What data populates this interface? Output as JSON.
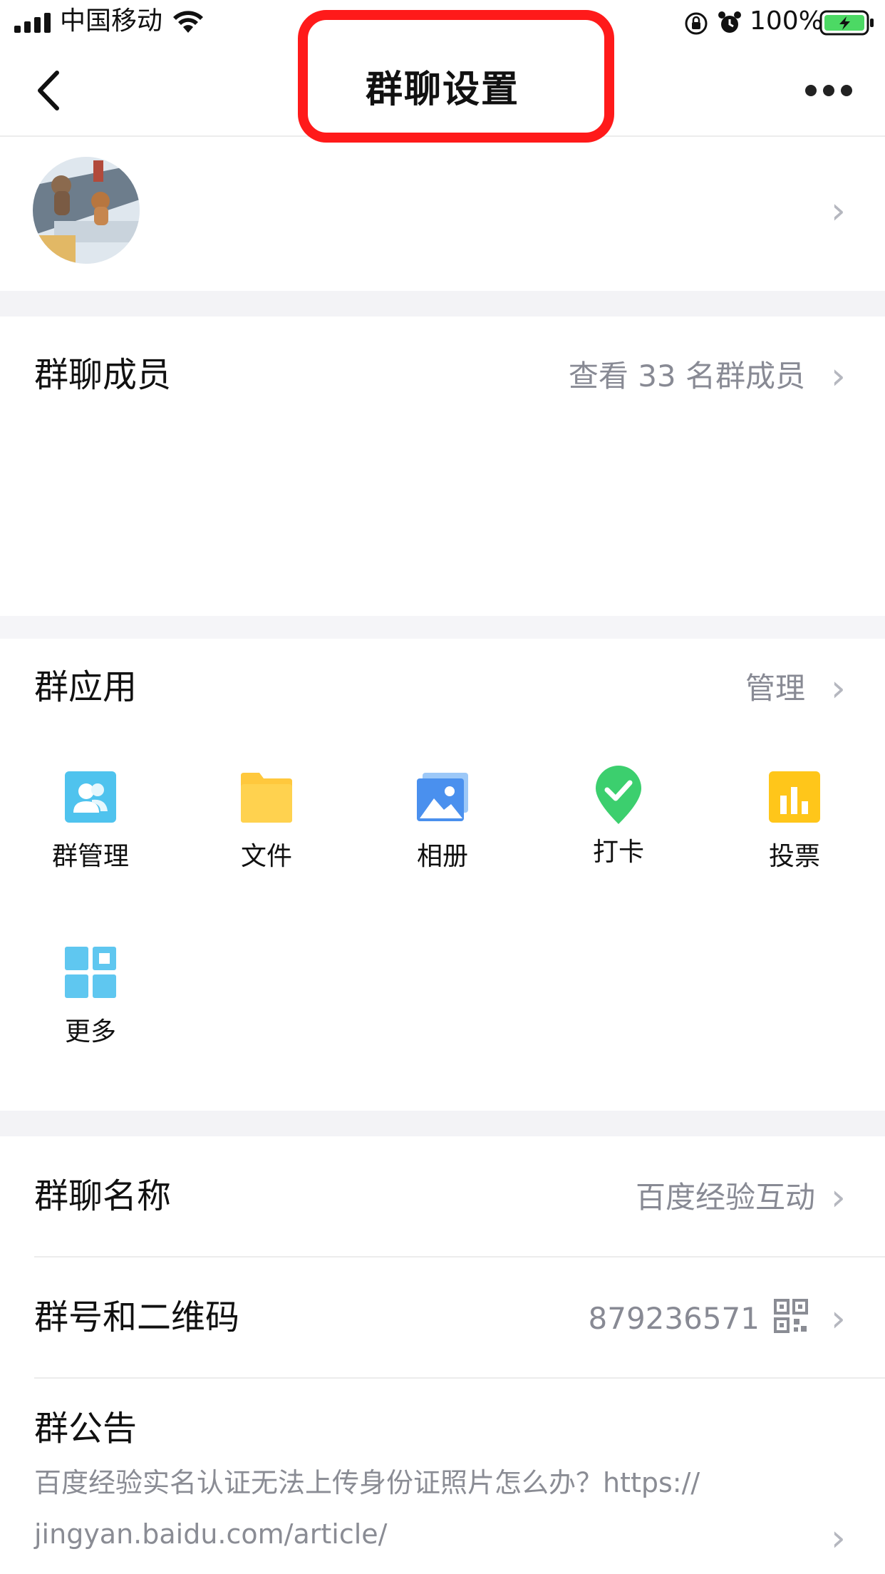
{
  "status": {
    "carrier": "中国移动",
    "battery": "100%"
  },
  "nav": {
    "title": "群聊设置"
  },
  "members": {
    "label": "群聊成员",
    "view_all": "查看 33 名群成员"
  },
  "apps": {
    "label": "群应用",
    "manage": "管理",
    "items": [
      {
        "label": "群管理",
        "icon": "group-manage-icon"
      },
      {
        "label": "文件",
        "icon": "folder-icon"
      },
      {
        "label": "相册",
        "icon": "photo-album-icon"
      },
      {
        "label": "打卡",
        "icon": "checkin-icon"
      },
      {
        "label": "投票",
        "icon": "vote-icon"
      },
      {
        "label": "更多",
        "icon": "more-apps-icon"
      }
    ]
  },
  "group_name": {
    "label": "群聊名称",
    "value": "百度经验互动"
  },
  "group_id": {
    "label": "群号和二维码",
    "value": "879236571"
  },
  "notice": {
    "label": "群公告",
    "line1": "百度经验实名认证无法上传身份证照片怎么办？https://",
    "line2": "jingyan.baidu.com/article/"
  },
  "colors": {
    "highlight": "#ff1a1a",
    "battery": "#4cd964"
  }
}
